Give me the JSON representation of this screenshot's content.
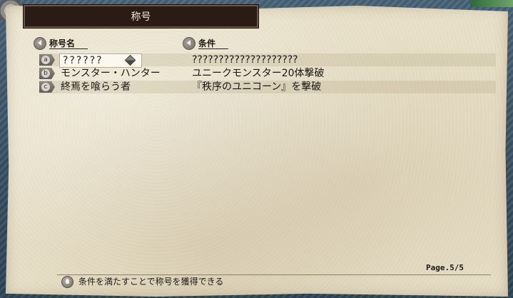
{
  "title": "称号",
  "columns": {
    "name_header": "称号名",
    "condition_header": "条件"
  },
  "rows": [
    {
      "letter": "a",
      "name": "??????",
      "condition": "????????????????????",
      "selected": true
    },
    {
      "letter": "b",
      "name": "モンスター・ハンター",
      "condition": "ユニークモンスター20体撃破",
      "selected": false
    },
    {
      "letter": "c",
      "name": "終焉を喰らう者",
      "condition": "『秩序のユニコーン』を撃破",
      "selected": false
    }
  ],
  "page_indicator": "Page.5/5",
  "hint": "条件を満たすことで称号を獲得できる",
  "icons": {
    "column_header": "arrow-left-icon",
    "row_badge": "letter-badge-icon",
    "selected_marker": "diamond-icon",
    "hint": "lightbulb-icon"
  },
  "colors": {
    "title_bar": "#2a1c14",
    "parchment": "#e8dfc7",
    "text": "#1a1612"
  }
}
